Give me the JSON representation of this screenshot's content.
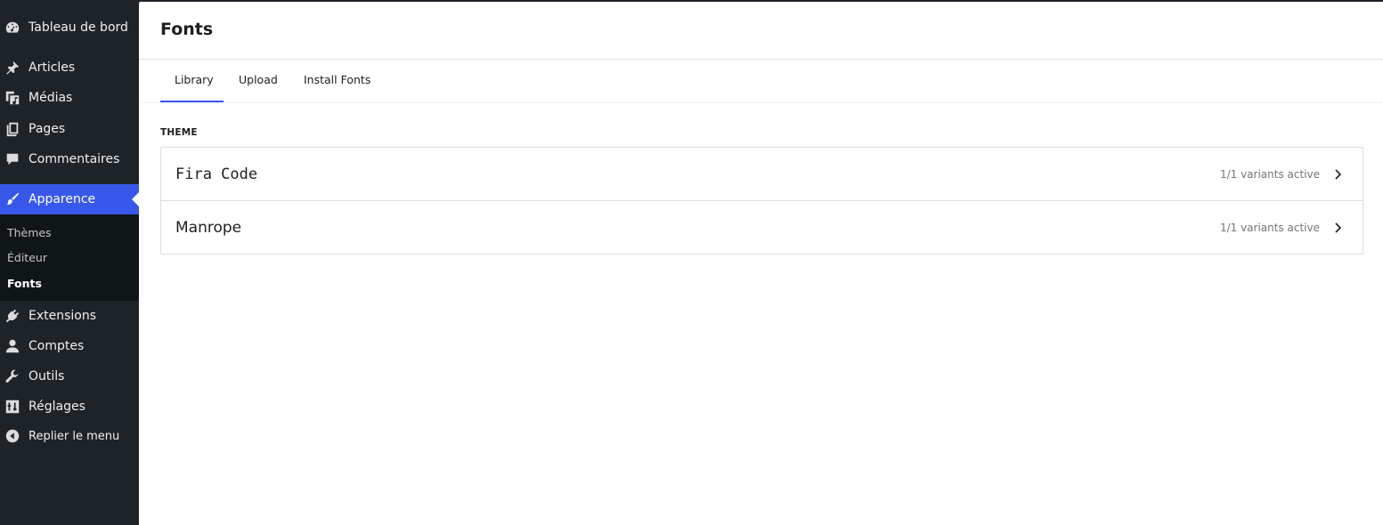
{
  "sidebar": {
    "items": [
      {
        "label": "Tableau de bord",
        "icon": "dashboard-icon"
      },
      {
        "label": "Articles",
        "icon": "pin-icon"
      },
      {
        "label": "Médias",
        "icon": "media-icon"
      },
      {
        "label": "Pages",
        "icon": "pages-icon"
      },
      {
        "label": "Commentaires",
        "icon": "comment-icon"
      },
      {
        "label": "Apparence",
        "icon": "brush-icon",
        "active": true
      },
      {
        "label": "Extensions",
        "icon": "plugin-icon"
      },
      {
        "label": "Comptes",
        "icon": "user-icon"
      },
      {
        "label": "Outils",
        "icon": "wrench-icon"
      },
      {
        "label": "Réglages",
        "icon": "settings-icon"
      },
      {
        "label": "Replier le menu",
        "icon": "collapse-icon"
      }
    ],
    "submenu": [
      {
        "label": "Thèmes"
      },
      {
        "label": "Éditeur"
      },
      {
        "label": "Fonts",
        "current": true
      }
    ]
  },
  "page": {
    "title": "Fonts",
    "tabs": [
      {
        "label": "Library",
        "selected": true
      },
      {
        "label": "Upload"
      },
      {
        "label": "Install Fonts"
      }
    ],
    "section_label": "THEME",
    "fonts": [
      {
        "name": "Fira Code",
        "meta": "1/1 variants active"
      },
      {
        "name": "Manrope",
        "meta": "1/1 variants active"
      }
    ]
  },
  "colors": {
    "sidebar_bg": "#1d2327",
    "accent": "#3858e9",
    "submenu_bg": "#101517"
  }
}
